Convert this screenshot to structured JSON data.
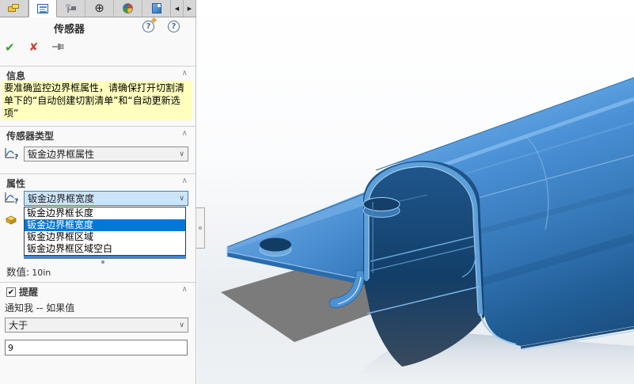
{
  "colors": {
    "selection_blue": "#0078d7",
    "focus_combo_bg": "#cce4f7",
    "info_bg": "#ffffbe",
    "accent_green": "#3f9c35",
    "accent_red": "#d23f31",
    "model_blue": "#3f85c9",
    "model_dark_blue": "#16466f",
    "shadow_gray": "#7b7b7b"
  },
  "glyphs": {
    "ok": "✔",
    "cancel": "✘",
    "collapse": "∧",
    "dropdown": "∨",
    "check": "✔",
    "scroll_left": "◀",
    "scroll_right": "▶",
    "help": "?",
    "dimxpert": "⊕"
  },
  "tab_bar": {
    "tabs": [
      "featuremanager-design-tree",
      "propertymanager",
      "configurationmanager",
      "dimxpertmanager",
      "displaymanager",
      "custom-tab"
    ],
    "active_tab": "propertymanager"
  },
  "header": {
    "title": "传感器"
  },
  "info": {
    "label": "信息",
    "message": "要准确监控边界框属性，请确保打开切割清单下的“自动创建切割清单”和“自动更新选项”"
  },
  "sensor_type": {
    "label": "传感器类型",
    "value": "钣金边界框属性"
  },
  "properties": {
    "label": "属性",
    "value": "钣金边界框宽度",
    "options": [
      "钣金边界框长度",
      "钣金边界框宽度",
      "钣金边界框区域",
      "钣金边界框区域空白"
    ],
    "selected_option": "钣金边界框宽度"
  },
  "value_row": {
    "label": "数值:",
    "value": "10in"
  },
  "alert": {
    "label": "提醒",
    "checked": true,
    "condition_text": "通知我 -- 如果值",
    "operator": "大于",
    "threshold": "9"
  }
}
